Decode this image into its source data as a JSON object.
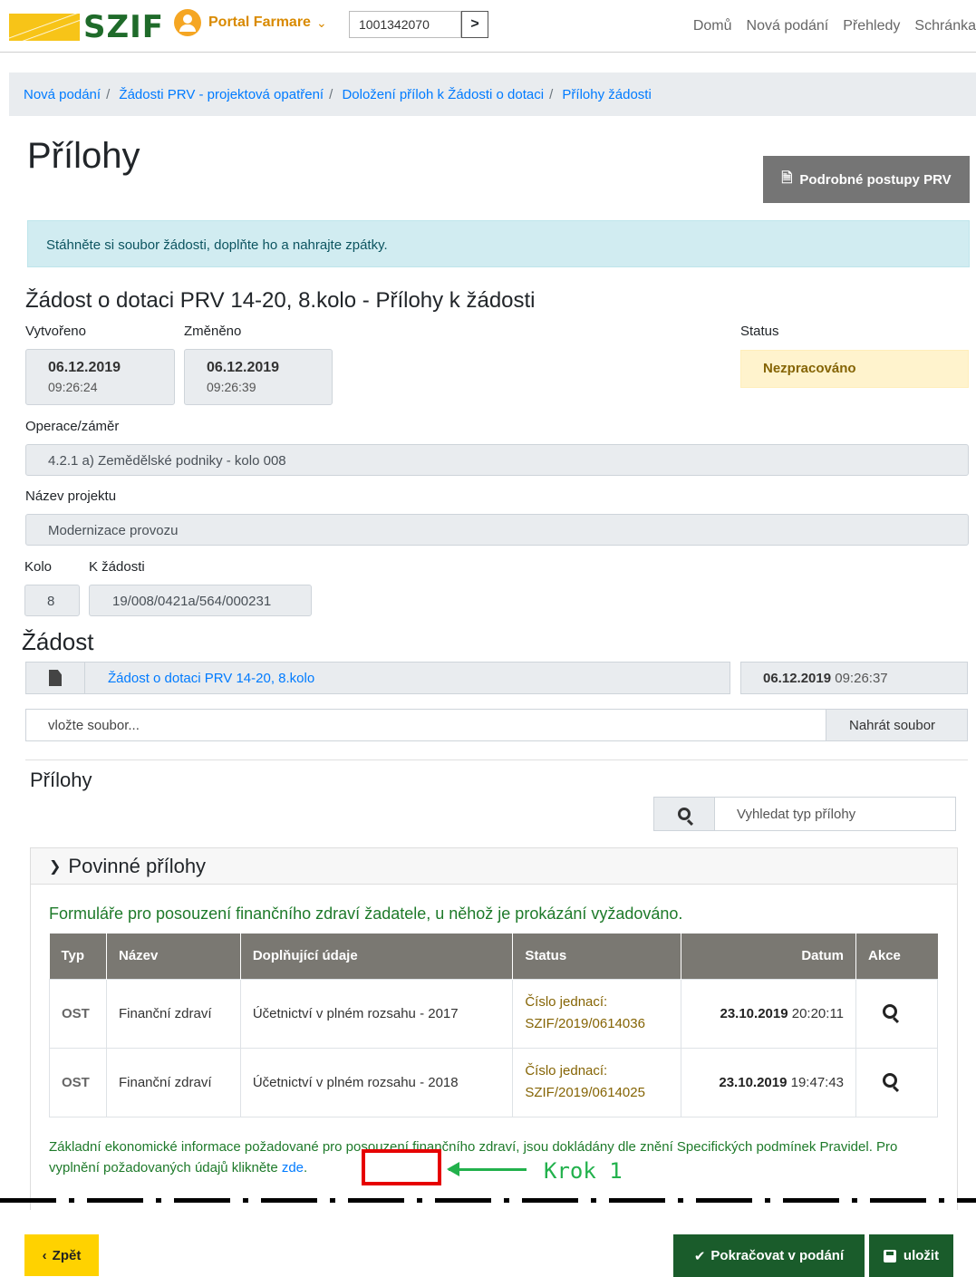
{
  "header": {
    "logo_text": "SZIF",
    "portal_label": "Portal Farmare",
    "id_value": "1001342070",
    "nav": [
      "Domů",
      "Nová podání",
      "Přehledy",
      "Schránka"
    ]
  },
  "breadcrumb": [
    "Nová podání",
    "Žádosti PRV - projektová opatření",
    "Doložení příloh k Žádosti o dotaci",
    "Přílohy žádosti"
  ],
  "page_title": "Přílohy",
  "postupy_button": "Podrobné postupy PRV",
  "alert": "Stáhněte si soubor žádosti, doplňte ho a nahrajte zpátky.",
  "request": {
    "title": "Žádost o dotaci PRV 14-20, 8.kolo - Přílohy k žádosti",
    "created_label": "Vytvořeno",
    "created_date": "06.12.2019",
    "created_time": "09:26:24",
    "changed_label": "Změněno",
    "changed_date": "06.12.2019",
    "changed_time": "09:26:39",
    "status_label": "Status",
    "status_value": "Nezpracováno",
    "operation_label": "Operace/záměr",
    "operation_value": "4.2.1 a) Zemědělské podniky - kolo 008",
    "project_label": "Název projektu",
    "project_value": "Modernizace provozu",
    "round_label": "Kolo",
    "round_value": "8",
    "ref_label": "K žádosti",
    "ref_value": "19/008/0421a/564/000231"
  },
  "zadost": {
    "title": "Žádost",
    "file_name": "Žádost o dotaci PRV 14-20, 8.kolo",
    "file_date": "06.12.2019",
    "file_time": "09:26:37",
    "upload_placeholder": "vložte soubor...",
    "upload_button": "Nahrát soubor"
  },
  "attachments": {
    "title": "Přílohy",
    "search_placeholder": "Vyhledat typ přílohy",
    "section_title": "Povinné přílohy",
    "group_title": "Formuláře pro posouzení finančního zdraví žadatele, u něhož je prokázání vyžadováno.",
    "columns": [
      "Typ",
      "Název",
      "Doplňující údaje",
      "Status",
      "Datum",
      "Akce"
    ],
    "rows": [
      {
        "typ": "OST",
        "nazev": "Finanční zdraví",
        "udaje": "Účetnictví v plném rozsahu - 2017",
        "status_1": "Číslo jednací:",
        "status_2": "SZIF/2019/0614036",
        "date": "23.10.2019",
        "time": "20:20:11"
      },
      {
        "typ": "OST",
        "nazev": "Finanční zdraví",
        "udaje": "Účetnictví v plném rozsahu - 2018",
        "status_1": "Číslo jednací:",
        "status_2": "SZIF/2019/0614025",
        "date": "23.10.2019",
        "time": "19:47:43"
      }
    ],
    "info_text": "Základní ekonomické informace požadované pro posouzení finančního zdraví, jsou dokládány dle znění Specifických podmínek Pravidel. Pro vyplnění požadovaných údajů klikněte ",
    "info_link": "zde",
    "info_end": "."
  },
  "annotation": {
    "label": "Krok 1",
    "highlight_color": "#e60000",
    "arrow_color": "#22b14c"
  },
  "footer": {
    "back": "Zpět",
    "continue": "Pokračovat v podání",
    "save": "uložit"
  }
}
